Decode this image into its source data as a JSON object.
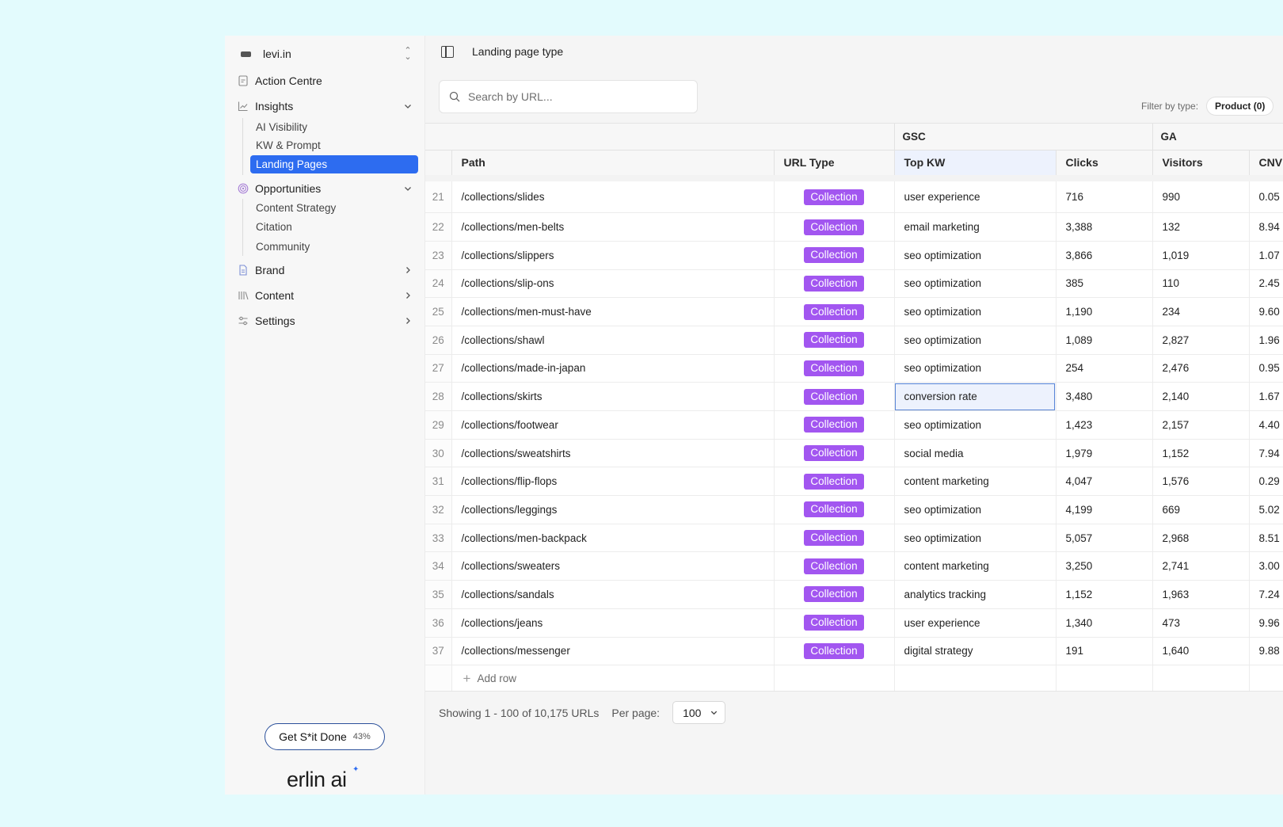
{
  "workspace": {
    "name": "levi.in"
  },
  "sidebar": {
    "nav": [
      {
        "label": "Action Centre"
      },
      {
        "label": "Insights",
        "children": [
          {
            "label": "AI Visibility"
          },
          {
            "label": "KW & Prompt"
          },
          {
            "label": "Landing Pages",
            "active": true
          }
        ]
      },
      {
        "label": "Opportunities",
        "children": [
          {
            "label": "Content Strategy"
          },
          {
            "label": "Citation"
          },
          {
            "label": "Community"
          }
        ]
      },
      {
        "label": "Brand"
      },
      {
        "label": "Content"
      },
      {
        "label": "Settings"
      }
    ],
    "progress_button": {
      "label": "Get S*it Done",
      "percent": "43%"
    },
    "brand": "erlin ai"
  },
  "header": {
    "title": "Landing page type"
  },
  "search": {
    "placeholder": "Search by URL..."
  },
  "filter": {
    "label": "Filter by type:",
    "chip": "Product (0)"
  },
  "table": {
    "groups": {
      "gsc": "GSC",
      "ga": "GA"
    },
    "columns": {
      "path": "Path",
      "url_type": "URL Type",
      "top_kw": "Top KW",
      "clicks": "Clicks",
      "visitors": "Visitors",
      "cnv": "CNV"
    },
    "rows": [
      {
        "n": "21",
        "path": "/collections/slides",
        "type": "Collection",
        "kw": "user experience",
        "clicks": "716",
        "visitors": "990",
        "cnv": "0.05"
      },
      {
        "n": "22",
        "path": "/collections/men-belts",
        "type": "Collection",
        "kw": "email marketing",
        "clicks": "3,388",
        "visitors": "132",
        "cnv": "8.94"
      },
      {
        "n": "23",
        "path": "/collections/slippers",
        "type": "Collection",
        "kw": "seo optimization",
        "clicks": "3,866",
        "visitors": "1,019",
        "cnv": "1.07"
      },
      {
        "n": "24",
        "path": "/collections/slip-ons",
        "type": "Collection",
        "kw": "seo optimization",
        "clicks": "385",
        "visitors": "110",
        "cnv": "2.45"
      },
      {
        "n": "25",
        "path": "/collections/men-must-have",
        "type": "Collection",
        "kw": "seo optimization",
        "clicks": "1,190",
        "visitors": "234",
        "cnv": "9.60"
      },
      {
        "n": "26",
        "path": "/collections/shawl",
        "type": "Collection",
        "kw": "seo optimization",
        "clicks": "1,089",
        "visitors": "2,827",
        "cnv": "1.96"
      },
      {
        "n": "27",
        "path": "/collections/made-in-japan",
        "type": "Collection",
        "kw": "seo optimization",
        "clicks": "254",
        "visitors": "2,476",
        "cnv": "0.95"
      },
      {
        "n": "28",
        "path": "/collections/skirts",
        "type": "Collection",
        "kw": "conversion rate",
        "clicks": "3,480",
        "visitors": "2,140",
        "cnv": "1.67",
        "selected": true
      },
      {
        "n": "29",
        "path": "/collections/footwear",
        "type": "Collection",
        "kw": "seo optimization",
        "clicks": "1,423",
        "visitors": "2,157",
        "cnv": "4.40"
      },
      {
        "n": "30",
        "path": "/collections/sweatshirts",
        "type": "Collection",
        "kw": "social media",
        "clicks": "1,979",
        "visitors": "1,152",
        "cnv": "7.94"
      },
      {
        "n": "31",
        "path": "/collections/flip-flops",
        "type": "Collection",
        "kw": "content marketing",
        "clicks": "4,047",
        "visitors": "1,576",
        "cnv": "0.29"
      },
      {
        "n": "32",
        "path": "/collections/leggings",
        "type": "Collection",
        "kw": "seo optimization",
        "clicks": "4,199",
        "visitors": "669",
        "cnv": "5.02"
      },
      {
        "n": "33",
        "path": "/collections/men-backpack",
        "type": "Collection",
        "kw": "seo optimization",
        "clicks": "5,057",
        "visitors": "2,968",
        "cnv": "8.51"
      },
      {
        "n": "34",
        "path": "/collections/sweaters",
        "type": "Collection",
        "kw": "content marketing",
        "clicks": "3,250",
        "visitors": "2,741",
        "cnv": "3.00"
      },
      {
        "n": "35",
        "path": "/collections/sandals",
        "type": "Collection",
        "kw": "analytics tracking",
        "clicks": "1,152",
        "visitors": "1,963",
        "cnv": "7.24"
      },
      {
        "n": "36",
        "path": "/collections/jeans",
        "type": "Collection",
        "kw": "user experience",
        "clicks": "1,340",
        "visitors": "473",
        "cnv": "9.96"
      },
      {
        "n": "37",
        "path": "/collections/messenger",
        "type": "Collection",
        "kw": "digital strategy",
        "clicks": "191",
        "visitors": "1,640",
        "cnv": "9.88"
      }
    ],
    "add_row": "Add row"
  },
  "footer": {
    "showing": "Showing 1 - 100 of 10,175 URLs",
    "per_page_label": "Per page:",
    "per_page_value": "100"
  },
  "colors": {
    "accent": "#2d6cf0",
    "badge": "#a256f0",
    "selected_cell": "#edf2fd"
  }
}
